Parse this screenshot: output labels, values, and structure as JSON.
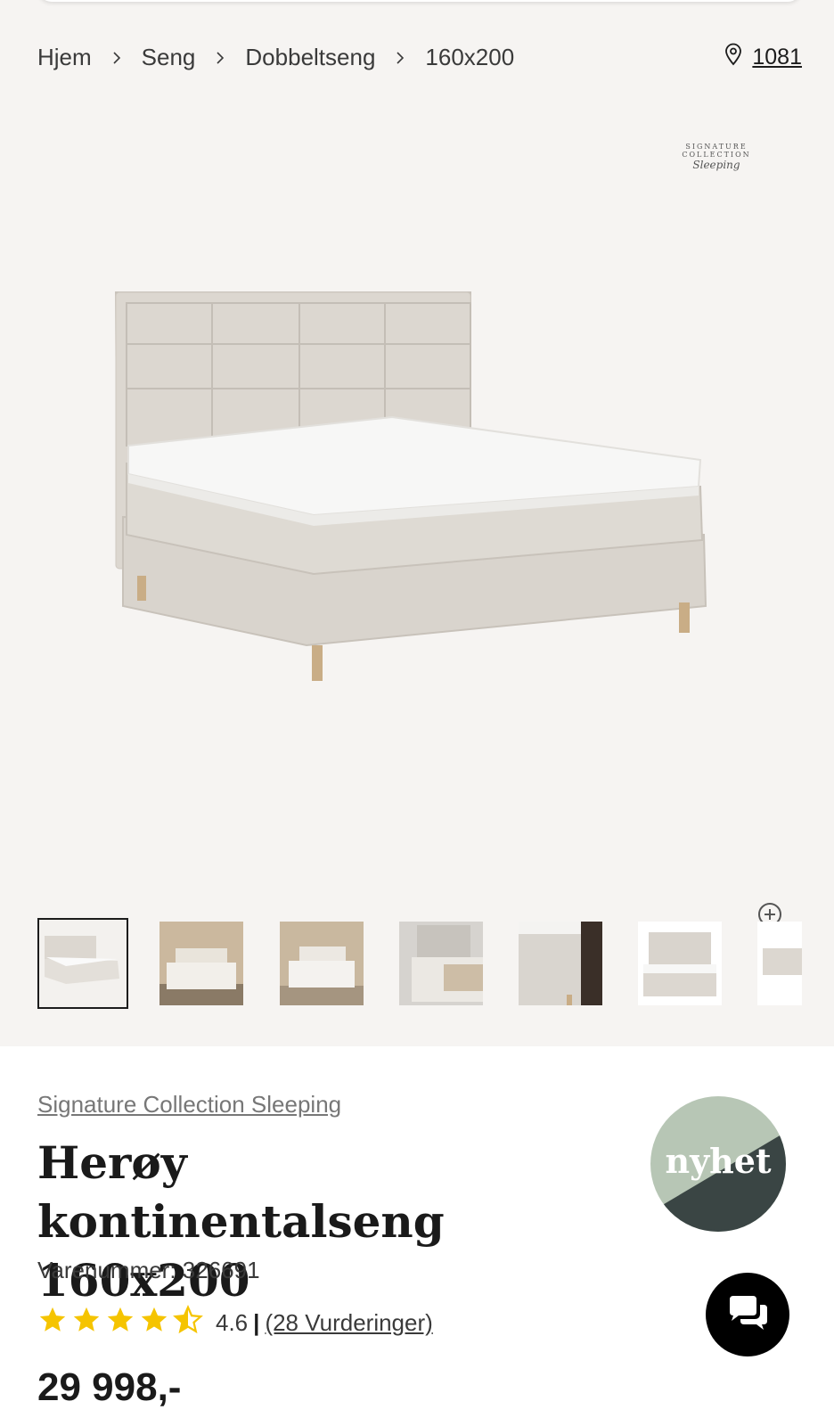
{
  "breadcrumb": {
    "items": [
      "Hjem",
      "Seng",
      "Dobbeltseng",
      "160x200"
    ],
    "store": "1081"
  },
  "gallery": {
    "brand_line1": "SIGNATURE COLLECTION",
    "brand_line2": "Sleeping",
    "thumbnail_count": 7,
    "active_thumbnail": 1
  },
  "product": {
    "brand": "Signature Collection Sleeping",
    "title_line1": "Herøy kontinentalseng",
    "title_line2": "160x200",
    "sku": "Varenummer: 326691",
    "rating": 4.6,
    "rating_text": "4.6",
    "reviews": "(28 Vurderinger)",
    "price": "29 998,-",
    "badge": "nyhet"
  },
  "colors": {
    "page_bg": "#f6f4f2",
    "badge_green": "#b7c6b5",
    "badge_dark": "#3a4544",
    "star": "#f5c400",
    "fabric": "#dcd7d0"
  },
  "icons": [
    "chevron-right-icon",
    "location-pin-icon",
    "zoom-in-icon",
    "star-icon",
    "star-half-icon",
    "chat-icon"
  ]
}
